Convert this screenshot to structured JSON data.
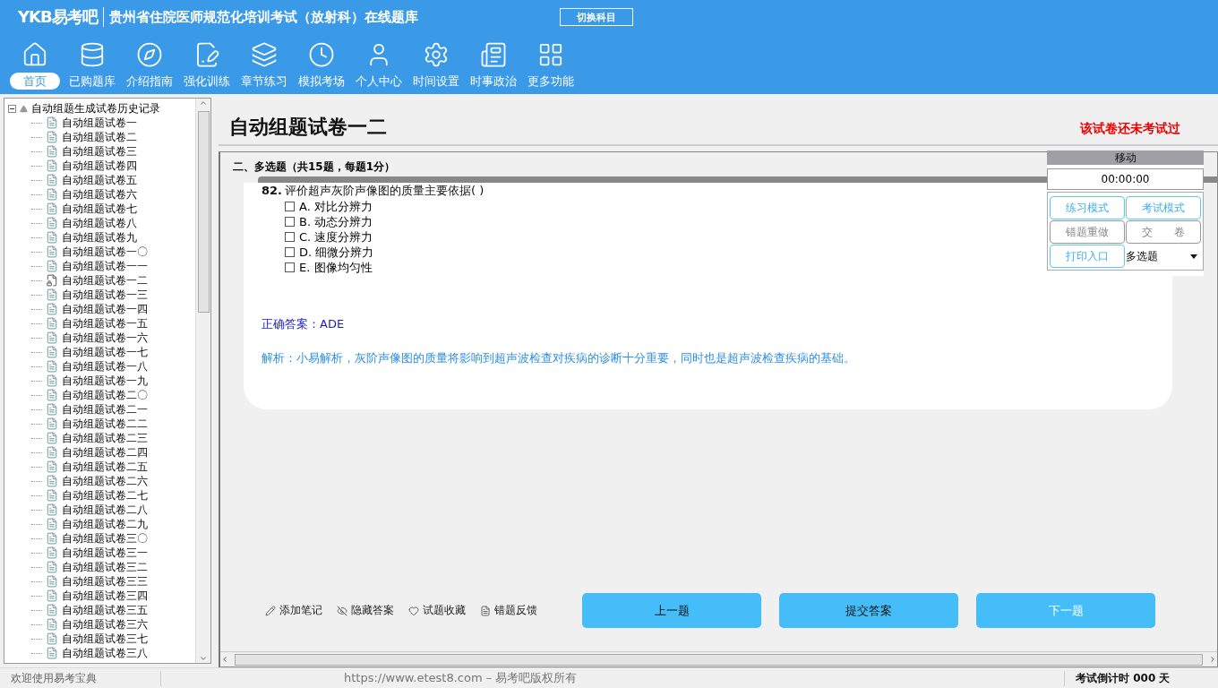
{
  "app": {
    "logo": "YKB易考吧",
    "title": "贵州省住院医师规范化培训考试（放射科）在线题库",
    "switch_button": "切换科目"
  },
  "nav": [
    {
      "label": "首页",
      "selected": true
    },
    {
      "label": "已购题库",
      "selected": false
    },
    {
      "label": "介绍指南",
      "selected": false
    },
    {
      "label": "强化训练",
      "selected": false
    },
    {
      "label": "章节练习",
      "selected": false
    },
    {
      "label": "模拟考场",
      "selected": false
    },
    {
      "label": "个人中心",
      "selected": false
    },
    {
      "label": "时间设置",
      "selected": false
    },
    {
      "label": "时事政治",
      "selected": false
    },
    {
      "label": "更多功能",
      "selected": false
    }
  ],
  "tree": {
    "label": "自动组题生成试卷历史记录",
    "expanded": true,
    "children": [
      {
        "label": "自动组题试卷一",
        "kind": "paper"
      },
      {
        "label": "自动组题试卷二",
        "kind": "paper"
      },
      {
        "label": "自动组题试卷三",
        "kind": "paper"
      },
      {
        "label": "自动组题试卷四",
        "kind": "paper"
      },
      {
        "label": "自动组题试卷五",
        "kind": "paper"
      },
      {
        "label": "自动组题试卷六",
        "kind": "paper"
      },
      {
        "label": "自动组题试卷七",
        "kind": "paper"
      },
      {
        "label": "自动组题试卷八",
        "kind": "paper"
      },
      {
        "label": "自动组题试卷九",
        "kind": "paper"
      },
      {
        "label": "自动组题试卷一〇",
        "kind": "paper"
      },
      {
        "label": "自动组题试卷一一",
        "kind": "paper"
      },
      {
        "label": "自动组题试卷一二",
        "kind": "current"
      },
      {
        "label": "自动组题试卷一三",
        "kind": "paper"
      },
      {
        "label": "自动组题试卷一四",
        "kind": "paper"
      },
      {
        "label": "自动组题试卷一五",
        "kind": "paper"
      },
      {
        "label": "自动组题试卷一六",
        "kind": "paper"
      },
      {
        "label": "自动组题试卷一七",
        "kind": "paper"
      },
      {
        "label": "自动组题试卷一八",
        "kind": "paper"
      },
      {
        "label": "自动组题试卷一九",
        "kind": "paper"
      },
      {
        "label": "自动组题试卷二〇",
        "kind": "paper"
      },
      {
        "label": "自动组题试卷二一",
        "kind": "paper"
      },
      {
        "label": "自动组题试卷二二",
        "kind": "paper"
      },
      {
        "label": "自动组题试卷二三",
        "kind": "paper"
      },
      {
        "label": "自动组题试卷二四",
        "kind": "paper"
      },
      {
        "label": "自动组题试卷二五",
        "kind": "paper"
      },
      {
        "label": "自动组题试卷二六",
        "kind": "paper"
      },
      {
        "label": "自动组题试卷二七",
        "kind": "paper"
      },
      {
        "label": "自动组题试卷二八",
        "kind": "paper"
      },
      {
        "label": "自动组题试卷二九",
        "kind": "paper"
      },
      {
        "label": "自动组题试卷三〇",
        "kind": "paper"
      },
      {
        "label": "自动组题试卷三一",
        "kind": "paper"
      },
      {
        "label": "自动组题试卷三二",
        "kind": "paper"
      },
      {
        "label": "自动组题试卷三三",
        "kind": "paper"
      },
      {
        "label": "自动组题试卷三四",
        "kind": "paper"
      },
      {
        "label": "自动组题试卷三五",
        "kind": "paper"
      },
      {
        "label": "自动组题试卷三六",
        "kind": "paper"
      },
      {
        "label": "自动组题试卷三七",
        "kind": "paper"
      },
      {
        "label": "自动组题试卷三八",
        "kind": "paper"
      }
    ]
  },
  "paper": {
    "title": "自动组题试卷一二",
    "status": "该试卷还未考试过",
    "section": "二、多选题（共15题，每题1分）",
    "question": {
      "number": "82.",
      "text": "评价超声灰阶声像图的质量主要依据( )",
      "options": [
        {
          "letter": "A.",
          "text": "对比分辨力",
          "checked": false
        },
        {
          "letter": "B.",
          "text": "动态分辨力",
          "checked": false
        },
        {
          "letter": "C.",
          "text": "速度分辨力",
          "checked": false
        },
        {
          "letter": "D.",
          "text": "细微分辨力",
          "checked": false
        },
        {
          "letter": "E.",
          "text": "图像均匀性",
          "checked": false
        }
      ],
      "answer_label": "正确答案：",
      "answer": "ADE",
      "analysis": "解析：小易解析，灰阶声像图的质量将影响到超声波检查对疾病的诊断十分重要，同时也是超声波检查疾病的基础。"
    },
    "actions": [
      {
        "label": "添加笔记"
      },
      {
        "label": "隐藏答案"
      },
      {
        "label": "试题收藏"
      },
      {
        "label": "错题反馈"
      }
    ],
    "buttons": [
      {
        "label": "上一题",
        "disabled": false
      },
      {
        "label": "提交答案",
        "disabled": false
      },
      {
        "label": "下一题",
        "disabled": true
      }
    ]
  },
  "panel": {
    "handle": "移动",
    "timer": "00:00:00",
    "buttons": [
      {
        "label": "练习模式",
        "kind": "blue"
      },
      {
        "label": "考试模式",
        "kind": "blue"
      },
      {
        "label": "错题重做",
        "kind": "grey"
      },
      {
        "label": "交　　卷",
        "kind": "grey"
      },
      {
        "label": "打印入口",
        "kind": "blue"
      }
    ],
    "select": {
      "value": "多选题"
    }
  },
  "status_bar": {
    "welcome": "欢迎使用易考宝典",
    "copyright": "https://www.etest8.com – 易考吧版权所有",
    "countdown": "考试倒计时 000 天"
  }
}
